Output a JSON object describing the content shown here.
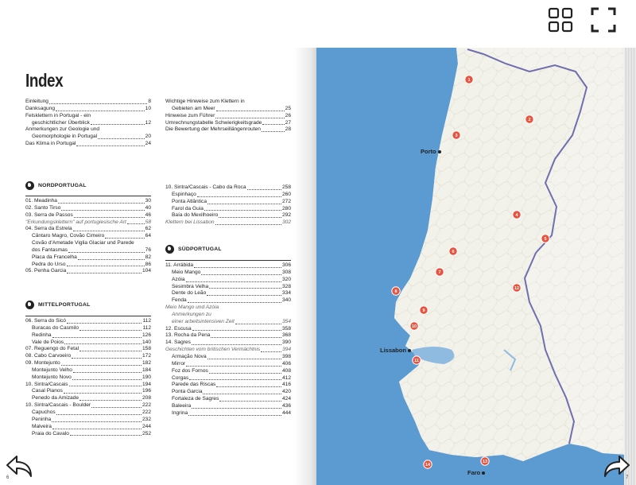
{
  "viewer": {
    "grid_icon": "grid-view-icon",
    "fullscreen_icon": "fullscreen-icon",
    "prev_icon": "arrow-back-icon",
    "next_icon": "arrow-forward-icon"
  },
  "left_page": {
    "title": "Index",
    "page_number": "6",
    "intro_col1": [
      {
        "label": "Einleitung",
        "page": "8"
      },
      {
        "label": "Danksagung",
        "page": "10"
      },
      {
        "label": "Felsklettern in Portugal - ein",
        "page": ""
      },
      {
        "label": "geschichtlicher Überblick",
        "page": "12",
        "indent": true
      },
      {
        "label": "Anmerkungen zur Geologie und",
        "page": ""
      },
      {
        "label": "Geomorphologie in Portugal",
        "page": "20",
        "indent": true
      },
      {
        "label": "Das Klima in Portugal",
        "page": "24"
      }
    ],
    "intro_col2": [
      {
        "label": "Wichtige Hinweise zum Klettern in",
        "page": ""
      },
      {
        "label": "Gebieten am Meer",
        "page": "25",
        "indent": true
      },
      {
        "label": "Hinweise zum Führer",
        "page": "26"
      },
      {
        "label": "Umrechnungstabelle Schwierigkeitsgrade",
        "page": "27"
      },
      {
        "label": "Die Bewertung der Mehrseillängenrouten",
        "page": "28"
      }
    ],
    "nord_heading": "NORDPORTUGAL",
    "nord": [
      {
        "label": "01. Meadinha",
        "page": "30"
      },
      {
        "label": "02. Santo Tirso",
        "page": "40"
      },
      {
        "label": "03. Serra de Passos",
        "page": "46"
      },
      {
        "label": "\"Erkundungsklettern\" auf portugiesische Art",
        "page": "58",
        "italic": true
      },
      {
        "label": "04. Serra da Estrela",
        "page": "62"
      },
      {
        "label": "Cântaro Magro, Covão Cimeiro",
        "page": "64",
        "indent": true
      },
      {
        "label": "Covão d'Ametade Viglia Glaciar und Parede",
        "page": "",
        "indent": true
      },
      {
        "label": "dos Fantasmas",
        "page": "76",
        "indent": true
      },
      {
        "label": "Placa da Francelha",
        "page": "82",
        "indent": true
      },
      {
        "label": "Pedra do Urso",
        "page": "86",
        "indent": true
      },
      {
        "label": "05. Penha Garcia",
        "page": "104"
      }
    ],
    "mittel_heading": "MITTELPORTUGAL",
    "mittel": [
      {
        "label": "06. Serra do Sicó",
        "page": "112"
      },
      {
        "label": "Buracas do Casmilo",
        "page": "112",
        "indent": true
      },
      {
        "label": "Redinha",
        "page": "126",
        "indent": true
      },
      {
        "label": "Vale de Poios",
        "page": "140",
        "indent": true
      },
      {
        "label": "07. Reguengo do Fetal",
        "page": "158"
      },
      {
        "label": "08. Cabo Carvoeiro",
        "page": "172"
      },
      {
        "label": "09. Montejunto",
        "page": "182"
      },
      {
        "label": "Montejunto Velho",
        "page": "184",
        "indent": true
      },
      {
        "label": "Montejunto Novo",
        "page": "190",
        "indent": true
      },
      {
        "label": "10. Sintra/Cascais",
        "page": "194"
      },
      {
        "label": "Casal Pianos",
        "page": "196",
        "indent": true
      },
      {
        "label": "Penedo da Amizade",
        "page": "208",
        "indent": true
      },
      {
        "label": "10. Sintra/Cascais - Boulder",
        "page": "222"
      },
      {
        "label": "Capuchos",
        "page": "222",
        "indent": true
      },
      {
        "label": "Peninha",
        "page": "232",
        "indent": true
      },
      {
        "label": "Malveira",
        "page": "244",
        "indent": true
      },
      {
        "label": "Praia do Cavalo",
        "page": "252",
        "indent": true
      }
    ],
    "col2_top": [
      {
        "label": "10. Sintra/Cascais - Cabo da Roca",
        "page": "258"
      },
      {
        "label": "Espinhaço",
        "page": "260",
        "indent": true
      },
      {
        "label": "Ponta Atlântica",
        "page": "272",
        "indent": true
      },
      {
        "label": "Farol da Guia",
        "page": "280",
        "indent": true
      },
      {
        "label": "Baía do Mexilhoeiro",
        "page": "292",
        "indent": true
      },
      {
        "label": "Klettern bei Lissabon",
        "page": "302",
        "italic": true
      }
    ],
    "sud_heading": "SÜDPORTUGAL",
    "sud": [
      {
        "label": "11. Arrábida",
        "page": "306"
      },
      {
        "label": "Meio Mango",
        "page": "308",
        "indent": true
      },
      {
        "label": "Azóia",
        "page": "320",
        "indent": true
      },
      {
        "label": "Sesimbra Velha",
        "page": "328",
        "indent": true
      },
      {
        "label": "Dente do Leão",
        "page": "334",
        "indent": true
      },
      {
        "label": "Fenda",
        "page": "340",
        "indent": true
      },
      {
        "label": "Meio Mango und Azóia",
        "page": "",
        "italic": true,
        "plain": true
      },
      {
        "label": "Anmerkungen zu",
        "page": "",
        "italic": true,
        "indent": true,
        "plain": true
      },
      {
        "label": "einer arbeitsintensiven Zeit",
        "page": "354",
        "italic": true,
        "indent": true
      },
      {
        "label": "12. Escusa",
        "page": "358"
      },
      {
        "label": "13. Rocha da Pena",
        "page": "368"
      },
      {
        "label": "14. Sagres",
        "page": "390"
      },
      {
        "label": "Geschichten vom britischen Vermächtnis",
        "page": "394",
        "italic": true
      },
      {
        "label": "Armação Nova",
        "page": "398",
        "indent": true
      },
      {
        "label": "Mirror",
        "page": "406",
        "indent": true
      },
      {
        "label": "Foz dos Fornos",
        "page": "408",
        "indent": true
      },
      {
        "label": "Corgas",
        "page": "412",
        "indent": true
      },
      {
        "label": "Parede das Riscas",
        "page": "416",
        "indent": true
      },
      {
        "label": "Ponta Garcia",
        "page": "420",
        "indent": true
      },
      {
        "label": "Fortaleza de Sagres",
        "page": "424",
        "indent": true
      },
      {
        "label": "Baleeira",
        "page": "436",
        "indent": true
      },
      {
        "label": "Ingrina",
        "page": "444",
        "indent": true
      }
    ]
  },
  "map": {
    "cities": [
      {
        "name": "Porto"
      },
      {
        "name": "Lissabon"
      },
      {
        "name": "Faro"
      }
    ],
    "markers": [
      "1",
      "2",
      "3",
      "4",
      "5",
      "6",
      "7",
      "8",
      "9",
      "10",
      "11",
      "12",
      "13",
      "14"
    ],
    "page_number": "7",
    "colors": {
      "ocean": "#5b9bd1",
      "land": "#f2f1ea",
      "spain": "#f4f3ee",
      "border": "#6f6fb0",
      "marker": "#e8533f"
    }
  }
}
